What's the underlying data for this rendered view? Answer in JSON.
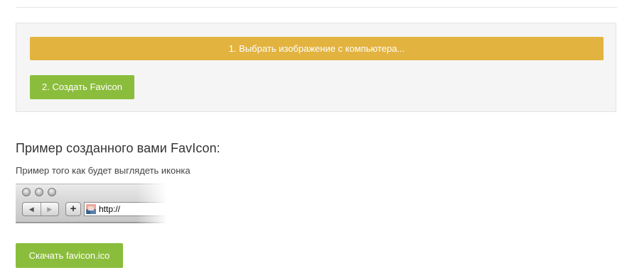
{
  "upload": {
    "choose_label": "1. Выбрать изображение с компьютера...",
    "create_label": "2. Создать Favicon"
  },
  "preview": {
    "title": "Пример созданного вами FavIcon:",
    "description": "Пример того как будет выглядеть иконка",
    "browser": {
      "address": "http://",
      "plus_label": "+",
      "back_icon": "arrow-left-icon",
      "forward_icon": "arrow-right-icon"
    }
  },
  "download": {
    "label": "Скачать favicon.ico"
  },
  "colors": {
    "choose_button": "#e2b33f",
    "green_button": "#8bbd3c",
    "panel_background": "#f5f5f5"
  }
}
